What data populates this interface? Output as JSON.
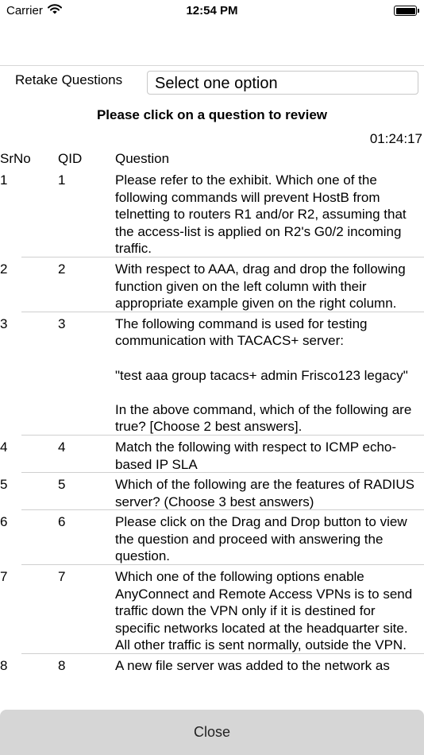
{
  "status_bar": {
    "carrier": "Carrier",
    "time": "12:54 PM"
  },
  "retake": {
    "label": "Retake Questions",
    "select_value": "Select one option"
  },
  "instruction": "Please click on a question to review",
  "timer": "01:24:17",
  "table": {
    "headers": {
      "srno": "SrNo",
      "qid": "QID",
      "question": "Question"
    },
    "rows": [
      {
        "srno": "1",
        "qid": "1",
        "question": "Please refer to the exhibit. Which one of the following commands will prevent HostB from telnetting to routers R1 and/or R2, assuming that the access-list is applied on R2's G0/2 incoming traffic."
      },
      {
        "srno": "2",
        "qid": "2",
        "question": "With respect to AAA, drag and drop the following function given on the left column with their appropriate example given on the right column."
      },
      {
        "srno": "3",
        "qid": "3",
        "question": "The following command is used for testing communication with TACACS+ server:\n\n\"test aaa group tacacs+ admin Frisco123 legacy\"\n\nIn the above command, which of the following are true? [Choose 2 best answers]."
      },
      {
        "srno": "4",
        "qid": "4",
        "question": "Match the following with respect to ICMP echo-based IP SLA"
      },
      {
        "srno": "5",
        "qid": "5",
        "question": "Which of the following are the features of RADIUS server? (Choose 3 best answers)"
      },
      {
        "srno": "6",
        "qid": "6",
        "question": "Please click on the Drag and Drop button to view the question and proceed with answering the question."
      },
      {
        "srno": "7",
        "qid": "7",
        "question": "Which one of the following options enable AnyConnect and Remote Access VPNs is to send traffic down the VPN only if it is destined for specific networks located at the headquarter site. All other traffic is sent normally, outside the VPN."
      },
      {
        "srno": "8",
        "qid": "8",
        "question": "A new file server was added to the network as"
      }
    ]
  },
  "close_label": "Close"
}
